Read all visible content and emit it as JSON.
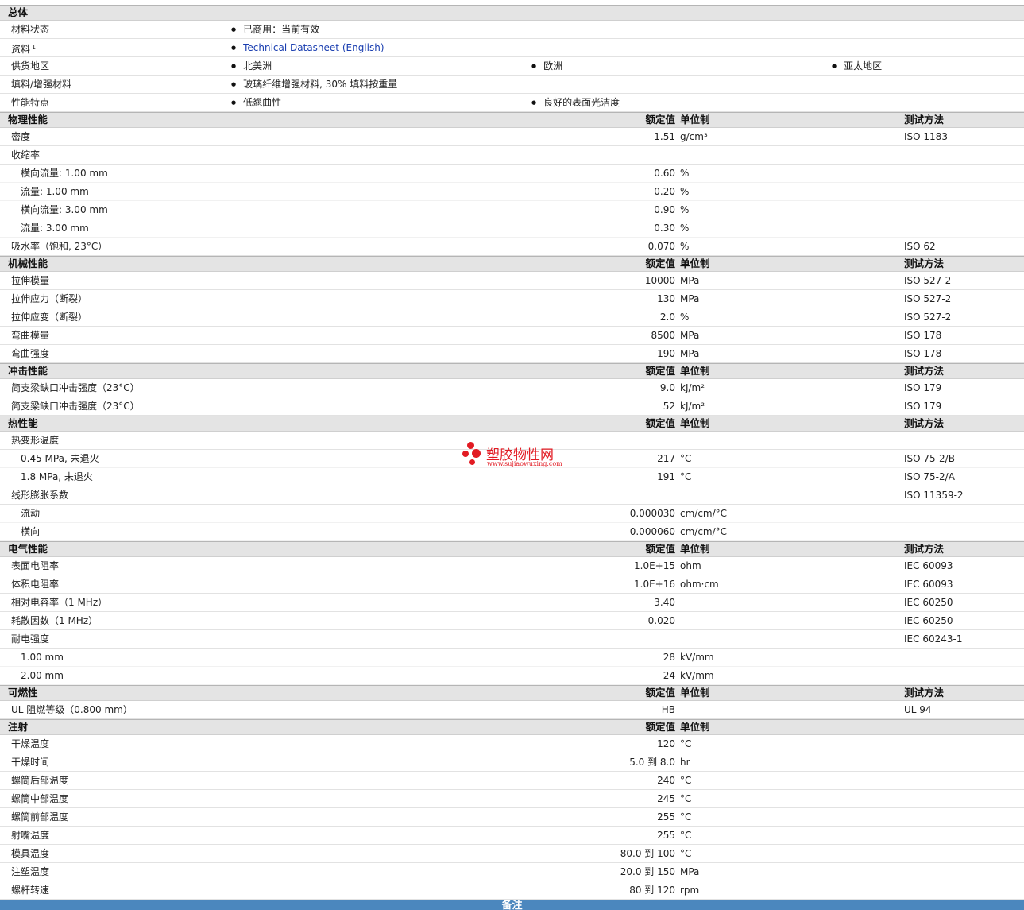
{
  "general": {
    "title": "总体",
    "rows": [
      {
        "label": "材料状态",
        "items": [
          "已商用：当前有效"
        ]
      },
      {
        "label": "资料",
        "sup": "1",
        "link": "Technical Datasheet (English)"
      },
      {
        "label": "供货地区",
        "items": [
          "北美洲",
          "欧洲",
          "亚太地区"
        ]
      },
      {
        "label": "填料/增强材料",
        "items": [
          "玻璃纤维增强材料, 30% 填料按重量"
        ]
      },
      {
        "label": "性能特点",
        "items": [
          "低翘曲性",
          "良好的表面光洁度"
        ]
      }
    ]
  },
  "headers": {
    "value": "额定值",
    "unit": "单位制",
    "test": "测试方法"
  },
  "sections": [
    {
      "title": "物理性能",
      "show_test": true,
      "rows": [
        {
          "label": "密度",
          "value": "1.51",
          "unit": "g/cm³",
          "test": "ISO 1183"
        },
        {
          "label": "收缩率"
        },
        {
          "label": "横向流量: 1.00 mm",
          "sub": true,
          "value": "0.60",
          "unit": "%"
        },
        {
          "label": "流量: 1.00 mm",
          "sub": true,
          "value": "0.20",
          "unit": "%"
        },
        {
          "label": "横向流量: 3.00 mm",
          "sub": true,
          "value": "0.90",
          "unit": "%"
        },
        {
          "label": "流量: 3.00 mm",
          "sub": true,
          "value": "0.30",
          "unit": "%"
        },
        {
          "label": "吸水率（饱和, 23°C）",
          "value": "0.070",
          "unit": "%",
          "test": "ISO 62"
        }
      ]
    },
    {
      "title": "机械性能",
      "show_test": true,
      "rows": [
        {
          "label": "拉伸模量",
          "value": "10000",
          "unit": "MPa",
          "test": "ISO 527-2"
        },
        {
          "label": "拉伸应力（断裂）",
          "value": "130",
          "unit": "MPa",
          "test": "ISO 527-2"
        },
        {
          "label": "拉伸应变（断裂）",
          "value": "2.0",
          "unit": "%",
          "test": "ISO 527-2"
        },
        {
          "label": "弯曲模量",
          "value": "8500",
          "unit": "MPa",
          "test": "ISO 178"
        },
        {
          "label": "弯曲强度",
          "value": "190",
          "unit": "MPa",
          "test": "ISO 178"
        }
      ]
    },
    {
      "title": "冲击性能",
      "show_test": true,
      "rows": [
        {
          "label": "简支梁缺口冲击强度（23°C）",
          "value": "9.0",
          "unit": "kJ/m²",
          "test": "ISO 179"
        },
        {
          "label": "简支梁缺口冲击强度（23°C）",
          "value": "52",
          "unit": "kJ/m²",
          "test": "ISO 179"
        }
      ]
    },
    {
      "title": "热性能",
      "show_test": true,
      "rows": [
        {
          "label": "热变形温度"
        },
        {
          "label": "0.45 MPa, 未退火",
          "sub": true,
          "value": "217",
          "unit": "°C",
          "test": "ISO 75-2/B"
        },
        {
          "label": "1.8 MPa, 未退火",
          "sub": true,
          "value": "191",
          "unit": "°C",
          "test": "ISO 75-2/A"
        },
        {
          "label": "线形膨胀系数",
          "test": "ISO 11359-2"
        },
        {
          "label": "流动",
          "sub": true,
          "value": "0.000030",
          "unit": "cm/cm/°C"
        },
        {
          "label": "横向",
          "sub": true,
          "value": "0.000060",
          "unit": "cm/cm/°C"
        }
      ]
    },
    {
      "title": "电气性能",
      "show_test": true,
      "rows": [
        {
          "label": "表面电阻率",
          "value": "1.0E+15",
          "unit": "ohm",
          "test": "IEC 60093"
        },
        {
          "label": "体积电阻率",
          "value": "1.0E+16",
          "unit": "ohm·cm",
          "test": "IEC 60093"
        },
        {
          "label": "相对电容率（1 MHz）",
          "value": "3.40",
          "test": "IEC 60250"
        },
        {
          "label": "耗散因数（1 MHz）",
          "value": "0.020",
          "test": "IEC 60250"
        },
        {
          "label": "耐电强度",
          "test": "IEC 60243-1"
        },
        {
          "label": "1.00 mm",
          "sub": true,
          "value": "28",
          "unit": "kV/mm"
        },
        {
          "label": "2.00 mm",
          "sub": true,
          "value": "24",
          "unit": "kV/mm"
        }
      ]
    },
    {
      "title": "可燃性",
      "show_test": true,
      "rows": [
        {
          "label": "UL 阻燃等级（0.800 mm）",
          "value": "HB",
          "test": "UL 94"
        }
      ]
    },
    {
      "title": "注射",
      "show_test": false,
      "rows": [
        {
          "label": "干燥温度",
          "value": "120",
          "unit": "°C"
        },
        {
          "label": "干燥时间",
          "value": "5.0 到  8.0",
          "unit": "hr"
        },
        {
          "label": "螺筒后部温度",
          "value": "240",
          "unit": "°C"
        },
        {
          "label": "螺筒中部温度",
          "value": "245",
          "unit": "°C"
        },
        {
          "label": "螺筒前部温度",
          "value": "255",
          "unit": "°C"
        },
        {
          "label": "射嘴温度",
          "value": "255",
          "unit": "°C"
        },
        {
          "label": "模具温度",
          "value": "80.0 到  100",
          "unit": "°C"
        },
        {
          "label": "注塑温度",
          "value": "20.0 到  150",
          "unit": "MPa"
        },
        {
          "label": "螺杆转速",
          "value": "80 到  120",
          "unit": "rpm"
        }
      ]
    }
  ],
  "notes": {
    "title": "备注"
  },
  "watermark": {
    "text": "塑胶物性网",
    "url": "www.sujiaowuxing.com",
    "color": "#e21b23"
  }
}
